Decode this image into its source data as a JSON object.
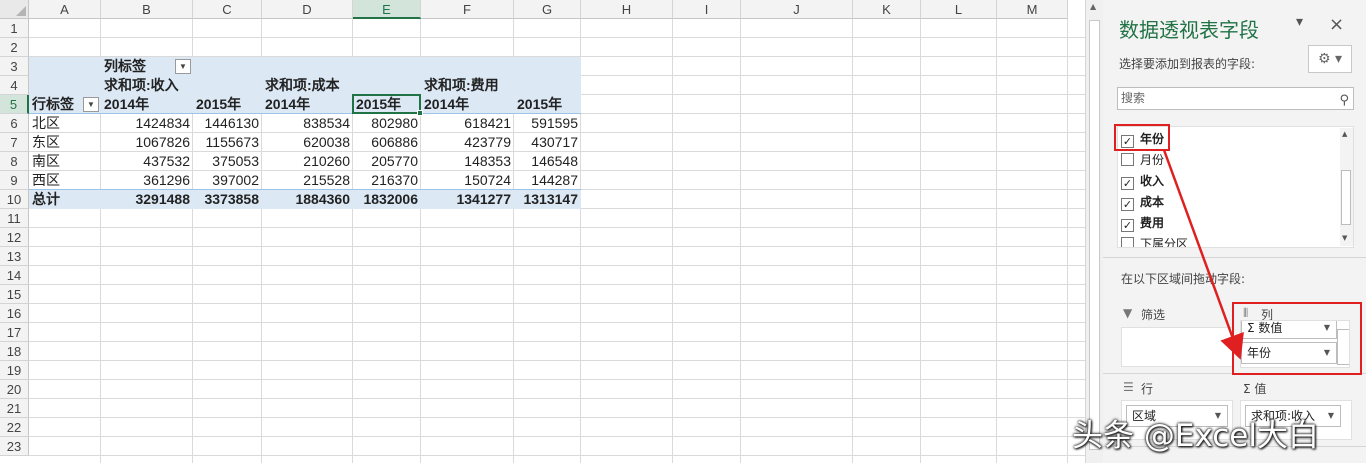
{
  "columns": [
    "A",
    "B",
    "C",
    "D",
    "E",
    "F",
    "G",
    "H",
    "I",
    "J",
    "K",
    "L",
    "M"
  ],
  "selected_column": "E",
  "rows": [
    "1",
    "2",
    "3",
    "4",
    "5",
    "6",
    "7",
    "8",
    "9",
    "10",
    "11",
    "12",
    "13",
    "14",
    "15",
    "16",
    "17",
    "18",
    "19",
    "20",
    "21",
    "22",
    "23"
  ],
  "selected_row": "5",
  "pivot": {
    "col_label_header": "列标签",
    "row_label_header": "行标签",
    "measures": [
      "求和项:收入",
      "求和项:成本",
      "求和项:费用"
    ],
    "years": [
      "2014年",
      "2015年"
    ],
    "rows": [
      {
        "label": "北区",
        "values": [
          "1424834",
          "1446130",
          "838534",
          "802980",
          "618421",
          "591595"
        ]
      },
      {
        "label": "东区",
        "values": [
          "1067826",
          "1155673",
          "620038",
          "606886",
          "423779",
          "430717"
        ]
      },
      {
        "label": "南区",
        "values": [
          "437532",
          "375053",
          "210260",
          "205770",
          "148353",
          "146548"
        ]
      },
      {
        "label": "西区",
        "values": [
          "361296",
          "397002",
          "215528",
          "216370",
          "150724",
          "144287"
        ]
      }
    ],
    "total": {
      "label": "总计",
      "values": [
        "3291488",
        "3373858",
        "1884360",
        "1832006",
        "1341277",
        "1313147"
      ]
    }
  },
  "pane": {
    "title": "数据透视表字段",
    "close_chevron": "▾",
    "close_x": "×",
    "choose_label": "选择要添加到报表的字段:",
    "gear_icon": "⚙",
    "search_placeholder": "搜索",
    "fields": [
      {
        "label": "年份",
        "checked": true,
        "bold": true
      },
      {
        "label": "月份",
        "checked": false,
        "bold": false
      },
      {
        "label": "收入",
        "checked": true,
        "bold": true
      },
      {
        "label": "成本",
        "checked": true,
        "bold": true
      },
      {
        "label": "费用",
        "checked": true,
        "bold": true
      },
      {
        "label": "下属分区",
        "checked": false,
        "bold": false
      }
    ],
    "drag_label": "在以下区域间拖动字段:",
    "filter_label": "筛选",
    "columns_label": "列",
    "columns_items": [
      "Σ 数值",
      "年份"
    ],
    "rows_label": "行",
    "rows_items": [
      "区域"
    ],
    "values_label": "Σ 值",
    "values_items": [
      "求和项:收入"
    ]
  },
  "watermark": "头条 @Excel大白",
  "colors": {
    "accent": "#217346",
    "pivot_fill": "#dce9f5",
    "highlight": "#e02020"
  }
}
